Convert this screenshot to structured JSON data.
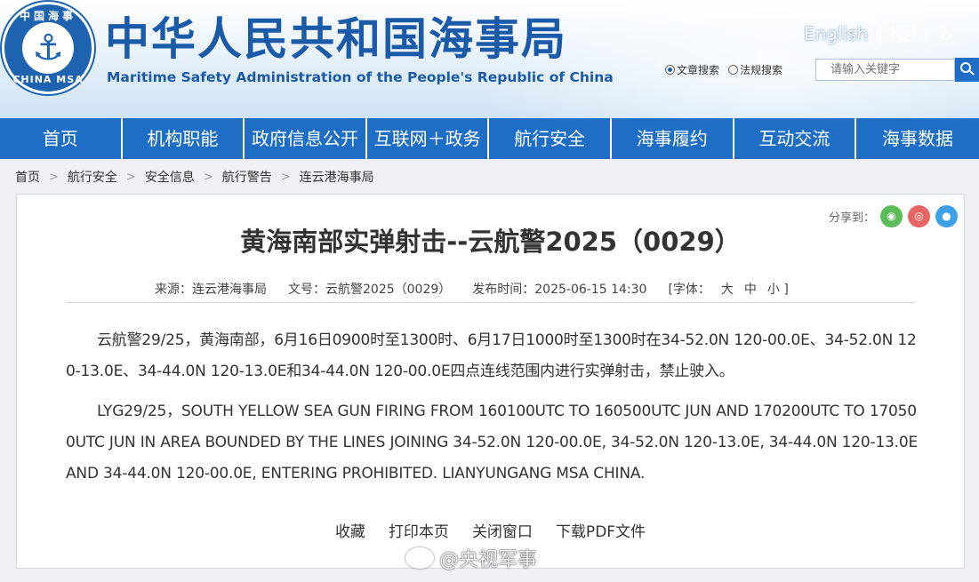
{
  "header": {
    "logo_ring_top": "中国海事",
    "logo_ring_bottom": "CHINA MSA",
    "title_cn": "中华人民共和国海事局",
    "title_en": "Maritime Safety Administration of the People's Republic of China",
    "english_link": "English",
    "separator": "|",
    "search": {
      "option_articles": "文章搜索",
      "option_regulations": "法规搜索",
      "placeholder": "请输入关键字"
    }
  },
  "nav": {
    "items": [
      {
        "label": "首页"
      },
      {
        "label": "机构职能"
      },
      {
        "label": "政府信息公开"
      },
      {
        "label": "互联网＋政务"
      },
      {
        "label": "航行安全"
      },
      {
        "label": "海事履约"
      },
      {
        "label": "互动交流"
      },
      {
        "label": "海事数据"
      }
    ]
  },
  "breadcrumb": {
    "items": [
      "首页",
      "航行安全",
      "安全信息",
      "航行警告",
      "连云港海事局"
    ],
    "separator": ">"
  },
  "article": {
    "share_label": "分享到：",
    "title": "黄海南部实弹射击--云航警2025（0029）",
    "meta": {
      "source": "来源：连云港海事局",
      "doc_no": "文号：云航警2025（0029）",
      "publish_time": "发布时间：2025-06-15 14:30",
      "font_label": "[字体：",
      "font_large": "大",
      "font_medium": "中",
      "font_small": "小 ]"
    },
    "para_cn": "云航警29/25，黄海南部，6月16日0900时至1300时、6月17日1000时至1300时在34-52.0N 120-00.0E、34-52.0N 120-13.0E、34-44.0N 120-13.0E和34-44.0N 120-00.0E四点连线范围内进行实弹射击，禁止驶入。",
    "para_en": "LYG29/25，SOUTH YELLOW SEA GUN FIRING FROM 160100UTC TO 160500UTC JUN AND 170200UTC TO 170500UTC JUN IN AREA BOUNDED BY THE LINES JOINING 34-52.0N 120-00.0E, 34-52.0N 120-13.0E, 34-44.0N 120-13.0E AND 34-44.0N 120-00.0E, ENTERING PROHIBITED. LIANYUNGANG MSA CHINA.",
    "actions": {
      "favorite": "收藏",
      "print": "打印本页",
      "close": "关闭窗口",
      "download_pdf": "下载PDF文件"
    }
  },
  "watermark": "@央视军事",
  "colors": {
    "primary_blue": "#1d6ec4",
    "title_blue": "#1a5aa8",
    "wechat_green": "#5bbd57",
    "weibo_red": "#e86565",
    "qq_blue": "#3ea1e8"
  }
}
